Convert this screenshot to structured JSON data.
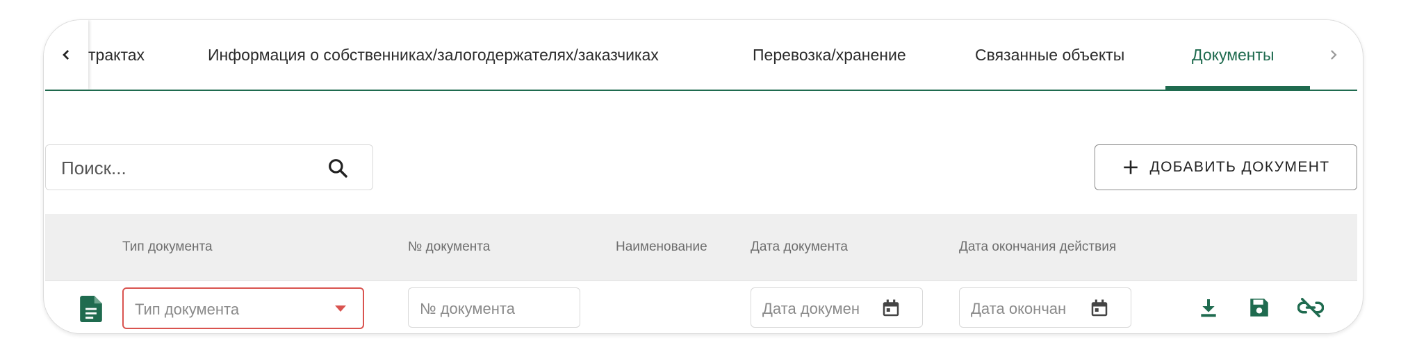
{
  "tabs": {
    "prev_icon": "chevron-left-icon",
    "next_icon": "chevron-right-icon",
    "items": [
      {
        "label": "трактах"
      },
      {
        "label": "Информация о собственниках/залогодержателях/заказчиках"
      },
      {
        "label": "Перевозка/хранение"
      },
      {
        "label": "Связанные объекты"
      },
      {
        "label": "Документы",
        "active": true
      }
    ],
    "accent_color": "#1f6b4f"
  },
  "search": {
    "placeholder": "Поиск...",
    "value": "",
    "icon": "search-icon"
  },
  "add_button": {
    "label": "ДОБАВИТЬ ДОКУМЕНТ",
    "icon": "plus-icon"
  },
  "table": {
    "columns": [
      "Тип документа",
      "№ документа",
      "Наименование",
      "Дата документа",
      "Дата окончания действия"
    ],
    "row": {
      "doc_icon": "document-icon",
      "type_placeholder": "Тип документа",
      "number_placeholder": "№ документа",
      "date_placeholder": "Дата докумен",
      "end_date_placeholder": "Дата окончан",
      "calendar_icon": "calendar-icon",
      "actions": [
        "download-icon",
        "save-icon",
        "unlink-icon"
      ],
      "error_color": "#d9534f"
    }
  }
}
